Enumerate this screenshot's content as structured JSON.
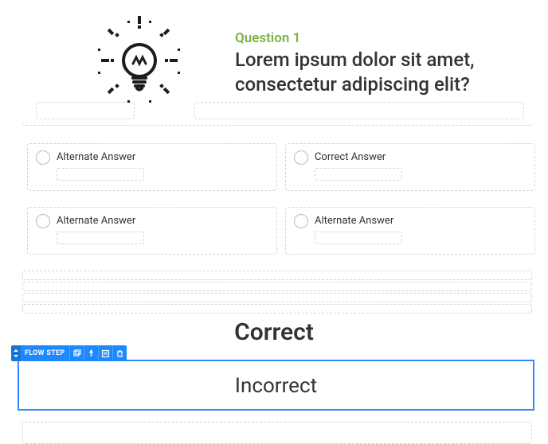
{
  "question": {
    "label": "Question 1",
    "text": "Lorem ipsum dolor sit amet, consectetur adipiscing elit?"
  },
  "answers": [
    {
      "label": "Alternate Answer"
    },
    {
      "label": "Correct Answer"
    },
    {
      "label": "Alternate Answer"
    },
    {
      "label": "Alternate Answer"
    }
  ],
  "results": {
    "correct": "Correct",
    "incorrect": "Incorrect"
  },
  "toolbar": {
    "label": "FLOW STEP"
  }
}
